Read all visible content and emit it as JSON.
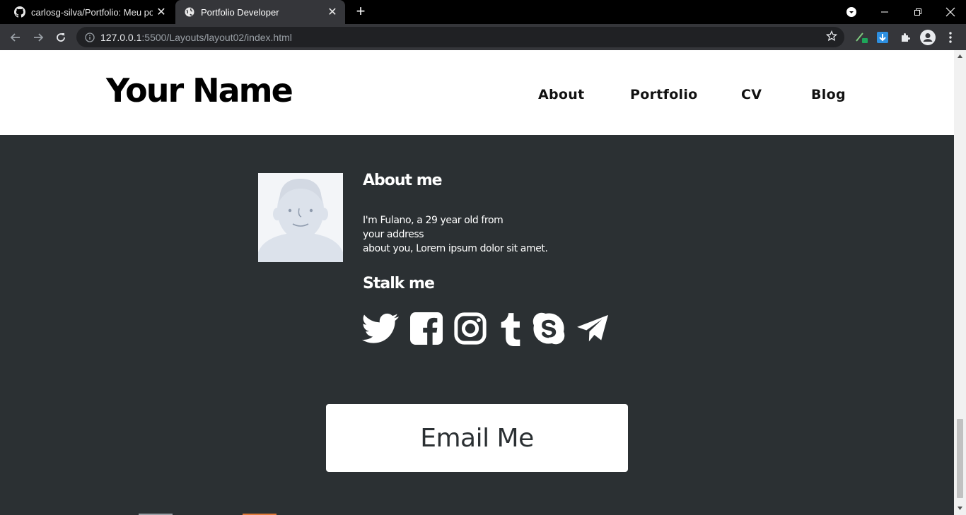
{
  "browser": {
    "tabs": [
      {
        "title": "carlosg-silva/Portfolio: Meu portf",
        "icon": "github-icon",
        "active": false
      },
      {
        "title": "Portfolio Developer",
        "icon": "globe-icon",
        "active": true
      }
    ],
    "address": {
      "host": "127.0.0.1",
      "path": ":5500/Layouts/layout02/index.html"
    }
  },
  "header": {
    "site_title": "Your Name",
    "nav": [
      "About",
      "Portfolio",
      "CV",
      "Blog"
    ]
  },
  "about": {
    "title": "About me",
    "lines": [
      "I'm Fulano, a 29 year old from",
      "your address",
      "about you, Lorem ipsum dolor sit amet."
    ]
  },
  "stalk": {
    "title": "Stalk me",
    "icons": [
      "twitter-icon",
      "facebook-icon",
      "instagram-icon",
      "tumblr-icon",
      "skype-icon",
      "telegram-icon"
    ]
  },
  "cta": {
    "label": "Email Me"
  },
  "colors": {
    "page_bg": "#2b3033",
    "header_bg": "#ffffff",
    "accent_hint": "#e07b39"
  }
}
